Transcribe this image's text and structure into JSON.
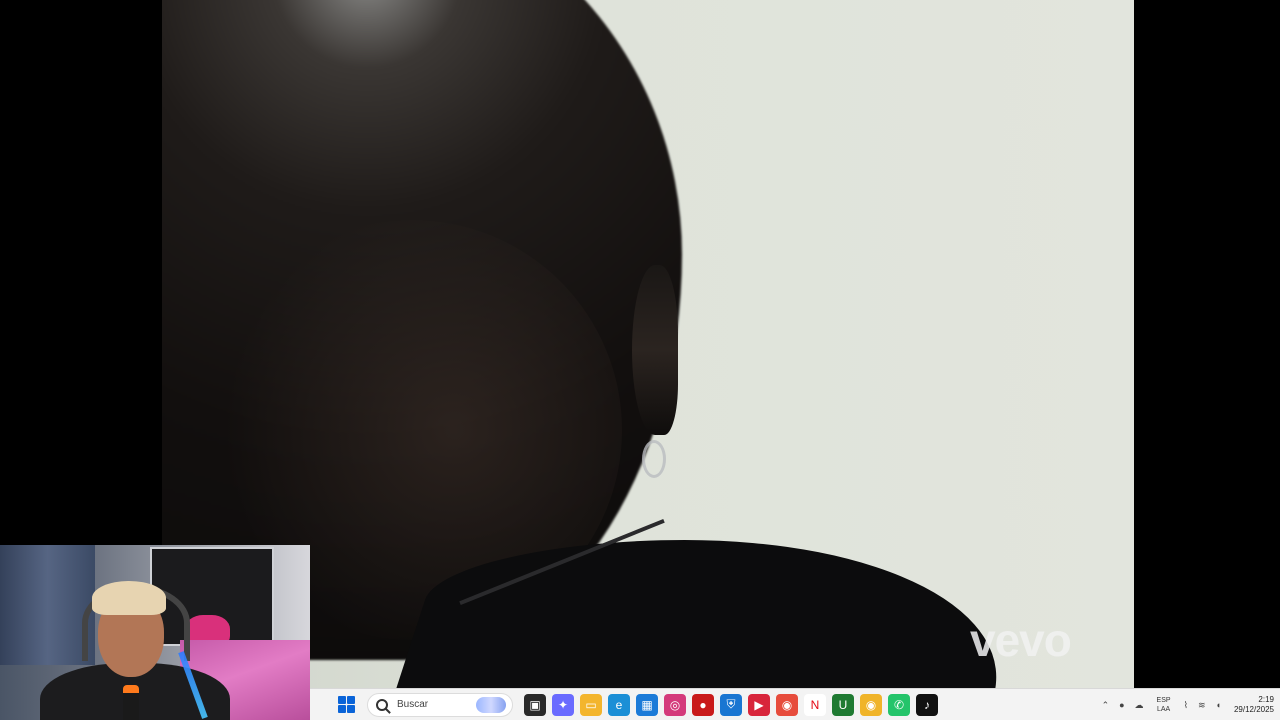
{
  "video": {
    "watermark": "vevo"
  },
  "taskbar": {
    "search_placeholder": "Buscar",
    "apps": [
      {
        "name": "task-view-icon",
        "color": "#2a2a2a",
        "glyph": "▣"
      },
      {
        "name": "copilot-icon",
        "color": "#6a6bff",
        "glyph": "✦"
      },
      {
        "name": "file-explorer-icon",
        "color": "#f3b52d",
        "glyph": "▭"
      },
      {
        "name": "edge-icon",
        "color": "#1b8fd6",
        "glyph": "e"
      },
      {
        "name": "microsoft-store-icon",
        "color": "#1c7bd8",
        "glyph": "▦"
      },
      {
        "name": "instagram-icon",
        "color": "#d43a7b",
        "glyph": "◎"
      },
      {
        "name": "record-app-icon",
        "color": "#c91a1a",
        "glyph": "●"
      },
      {
        "name": "vpn-shield-icon",
        "color": "#1976d2",
        "glyph": "⛨"
      },
      {
        "name": "video-app-icon",
        "color": "#d8253b",
        "glyph": "▶"
      },
      {
        "name": "chrome-icon",
        "color": "#e74c3c",
        "glyph": "◉"
      },
      {
        "name": "netflix-icon",
        "color": "#ffffff",
        "glyph": "N"
      },
      {
        "name": "utorrent-icon",
        "color": "#1f7a32",
        "glyph": "U"
      },
      {
        "name": "chrome-profile-icon",
        "color": "#f0b429",
        "glyph": "◉"
      },
      {
        "name": "whatsapp-icon",
        "color": "#24c46a",
        "glyph": "✆"
      },
      {
        "name": "tiktok-icon",
        "color": "#111111",
        "glyph": "♪"
      }
    ],
    "tray": {
      "lang_top": "ESP",
      "lang_bottom": "LAA",
      "time": "2:19",
      "date": "29/12/2025"
    }
  }
}
